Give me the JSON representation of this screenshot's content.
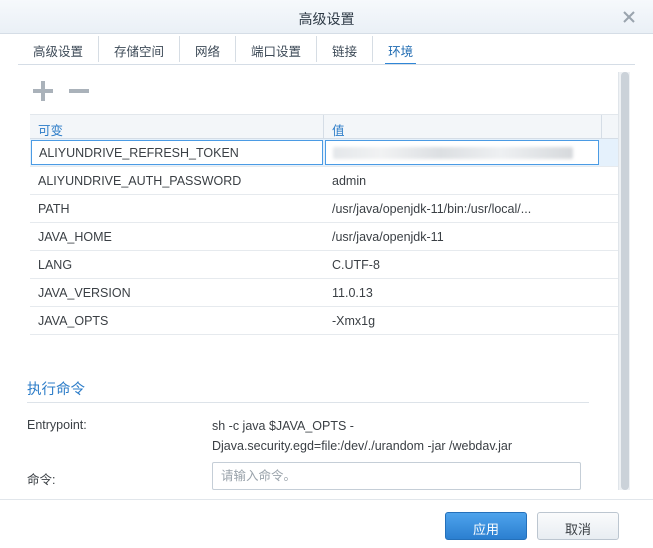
{
  "window": {
    "title": "高级设置"
  },
  "tabs": [
    {
      "label": "高级设置",
      "active": false
    },
    {
      "label": "存储空间",
      "active": false
    },
    {
      "label": "网络",
      "active": false
    },
    {
      "label": "端口设置",
      "active": false
    },
    {
      "label": "链接",
      "active": false
    },
    {
      "label": "环境",
      "active": true
    }
  ],
  "toolbar": {
    "add_icon": "plus-icon",
    "remove_icon": "minus-icon"
  },
  "env_table": {
    "headers": {
      "variable": "可变",
      "value": "值"
    },
    "rows": [
      {
        "key": "ALIYUNDRIVE_REFRESH_TOKEN",
        "value": ""
      },
      {
        "key": "ALIYUNDRIVE_AUTH_PASSWORD",
        "value": "admin"
      },
      {
        "key": "PATH",
        "value": "/usr/java/openjdk-11/bin:/usr/local/..."
      },
      {
        "key": "JAVA_HOME",
        "value": "/usr/java/openjdk-11"
      },
      {
        "key": "LANG",
        "value": "C.UTF-8"
      },
      {
        "key": "JAVA_VERSION",
        "value": "11.0.13"
      },
      {
        "key": "JAVA_OPTS",
        "value": "-Xmx1g"
      }
    ]
  },
  "exec": {
    "section_title": "执行命令",
    "entrypoint_label": "Entrypoint:",
    "entrypoint_line1": "sh -c java $JAVA_OPTS -",
    "entrypoint_line2": "Djava.security.egd=file:/dev/./urandom -jar /webdav.jar",
    "command_label": "命令:",
    "command_value": "",
    "command_placeholder": "请输入命令。"
  },
  "footer": {
    "apply_label": "应用",
    "cancel_label": "取消"
  },
  "colors": {
    "accent": "#2c7cc8",
    "primary_button": "#3a8fdd",
    "selected_row": "#e5f1fc"
  }
}
